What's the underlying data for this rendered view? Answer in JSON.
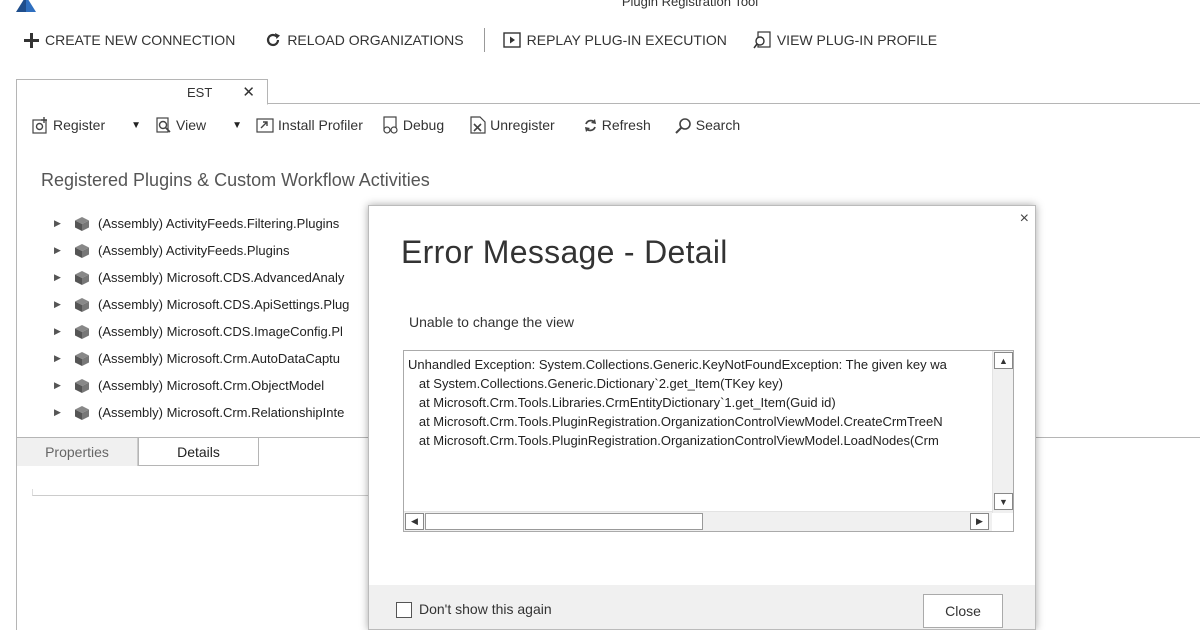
{
  "window": {
    "title": "Plugin Registration Tool"
  },
  "main_toolbar": {
    "create_connection": "CREATE NEW CONNECTION",
    "reload_organizations": "RELOAD ORGANIZATIONS",
    "replay_plugin": "REPLAY PLUG-IN EXECUTION",
    "view_profile": "VIEW PLUG-IN PROFILE"
  },
  "connection_tab": {
    "label": "EST",
    "close": "✕"
  },
  "inner_toolbar": {
    "register": "Register",
    "view": "View",
    "install_profiler": "Install Profiler",
    "debug": "Debug",
    "unregister": "Unregister",
    "refresh": "Refresh",
    "search": "Search"
  },
  "section_title": "Registered Plugins & Custom Workflow Activities",
  "tree": {
    "items": [
      "(Assembly) ActivityFeeds.Filtering.Plugins",
      "(Assembly) ActivityFeeds.Plugins",
      "(Assembly) Microsoft.CDS.AdvancedAnaly",
      "(Assembly) Microsoft.CDS.ApiSettings.Plug",
      "(Assembly) Microsoft.CDS.ImageConfig.Pl",
      "(Assembly) Microsoft.Crm.AutoDataCaptu",
      "(Assembly) Microsoft.Crm.ObjectModel",
      "(Assembly) Microsoft.Crm.RelationshipInte"
    ]
  },
  "lower_tabs": {
    "properties": "Properties",
    "details": "Details"
  },
  "modal": {
    "title": "Error Message - Detail",
    "subtitle": "Unable to change the view",
    "detail_lines": [
      "Unhandled Exception: System.Collections.Generic.KeyNotFoundException: The given key wa",
      "   at System.Collections.Generic.Dictionary`2.get_Item(TKey key)",
      "   at Microsoft.Crm.Tools.Libraries.CrmEntityDictionary`1.get_Item(Guid id)",
      "   at Microsoft.Crm.Tools.PluginRegistration.OrganizationControlViewModel.CreateCrmTreeN",
      "   at Microsoft.Crm.Tools.PluginRegistration.OrganizationControlViewModel.LoadNodes(Crm"
    ],
    "close_x": "×",
    "dont_show": "Don't show this again",
    "close_button": "Close"
  },
  "colors": {
    "accent": "#1f4e8c",
    "modal_footer": "#f0f0f0"
  }
}
